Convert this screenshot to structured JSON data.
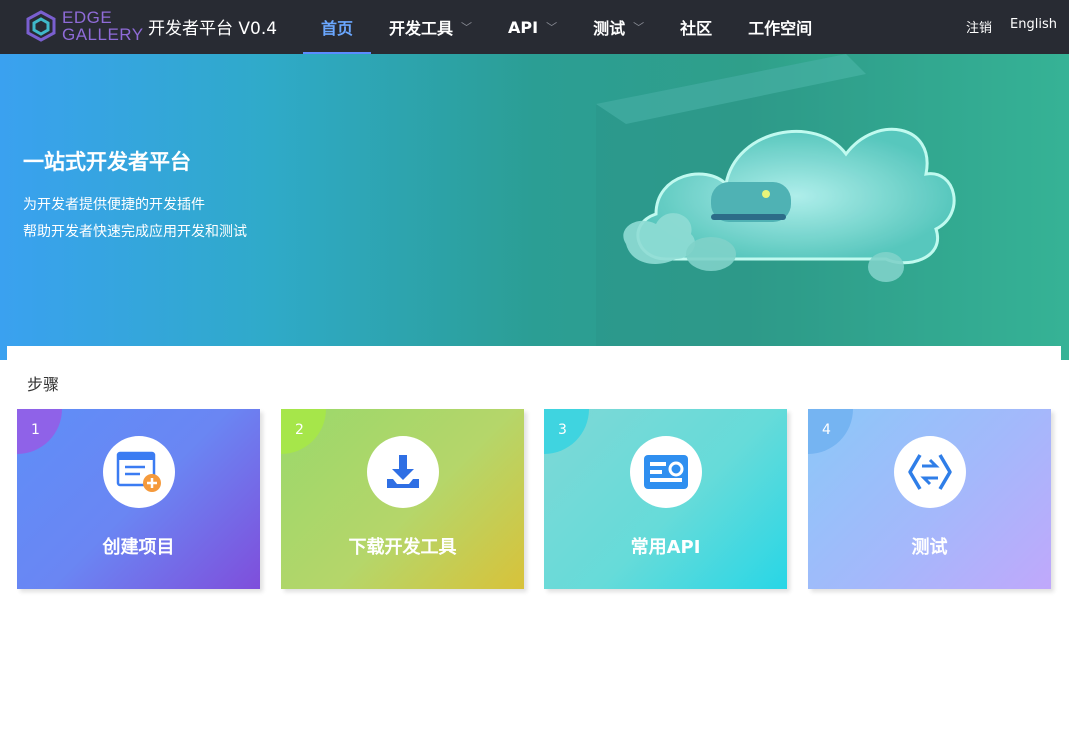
{
  "header": {
    "logo_line1": "EDGE",
    "logo_line2": "GALLERY",
    "platform_title": "开发者平台 V0.4",
    "nav": [
      {
        "label": "首页",
        "active": true,
        "dropdown": false
      },
      {
        "label": "开发工具",
        "active": false,
        "dropdown": true
      },
      {
        "label": "API",
        "active": false,
        "dropdown": true
      },
      {
        "label": "测试",
        "active": false,
        "dropdown": true
      },
      {
        "label": "社区",
        "active": false,
        "dropdown": false
      },
      {
        "label": "工作空间",
        "active": false,
        "dropdown": false
      }
    ],
    "logout": "注销",
    "language": "English"
  },
  "banner": {
    "title": "一站式开发者平台",
    "line1": "为开发者提供便捷的开发插件",
    "line2": "帮助开发者快速完成应用开发和测试"
  },
  "steps": {
    "title": "步骤",
    "cards": [
      {
        "num": "1",
        "label": "创建项目",
        "icon": "create-project-icon"
      },
      {
        "num": "2",
        "label": "下载开发工具",
        "icon": "download-icon"
      },
      {
        "num": "3",
        "label": "常用API",
        "icon": "api-card-icon"
      },
      {
        "num": "4",
        "label": "测试",
        "icon": "test-icon"
      }
    ]
  },
  "colors": {
    "header_bg": "#282b33",
    "nav_active": "#6aa7ff",
    "logo_purple": "#8f6bd8",
    "banner_start": "#3aa1f0",
    "banner_end": "#3cc69e"
  }
}
